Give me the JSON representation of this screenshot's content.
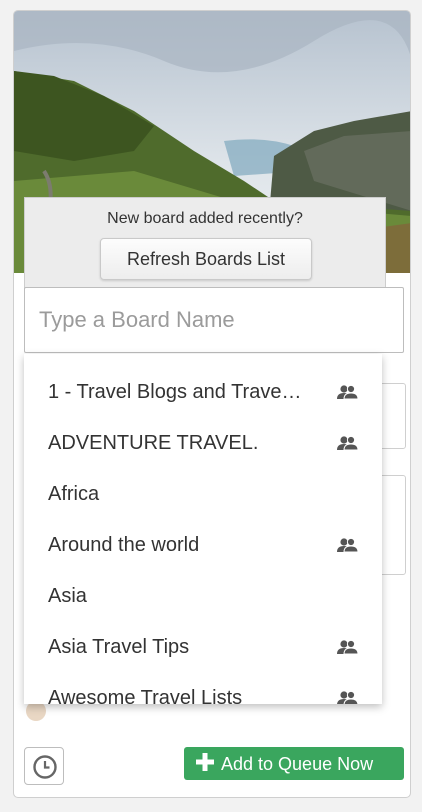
{
  "refresh_panel": {
    "prompt": "New board added recently?",
    "button_label": "Refresh Boards List"
  },
  "board_search": {
    "placeholder": "Type a Board Name",
    "value": ""
  },
  "boards": [
    {
      "name": "1 - Travel Blogs and Trave…",
      "group": true
    },
    {
      "name": "ADVENTURE TRAVEL.",
      "group": true
    },
    {
      "name": "Africa",
      "group": false
    },
    {
      "name": "Around the world",
      "group": true
    },
    {
      "name": "Asia",
      "group": false
    },
    {
      "name": "Asia Travel Tips",
      "group": true
    },
    {
      "name": "Awesome Travel Lists",
      "group": true
    }
  ],
  "footer": {
    "queue_button_label": "Add to Queue Now",
    "queue_button_color": "#3aa65e"
  },
  "icons": {
    "group": "group-board-icon",
    "history": "clock-icon",
    "add": "plus-icon"
  }
}
